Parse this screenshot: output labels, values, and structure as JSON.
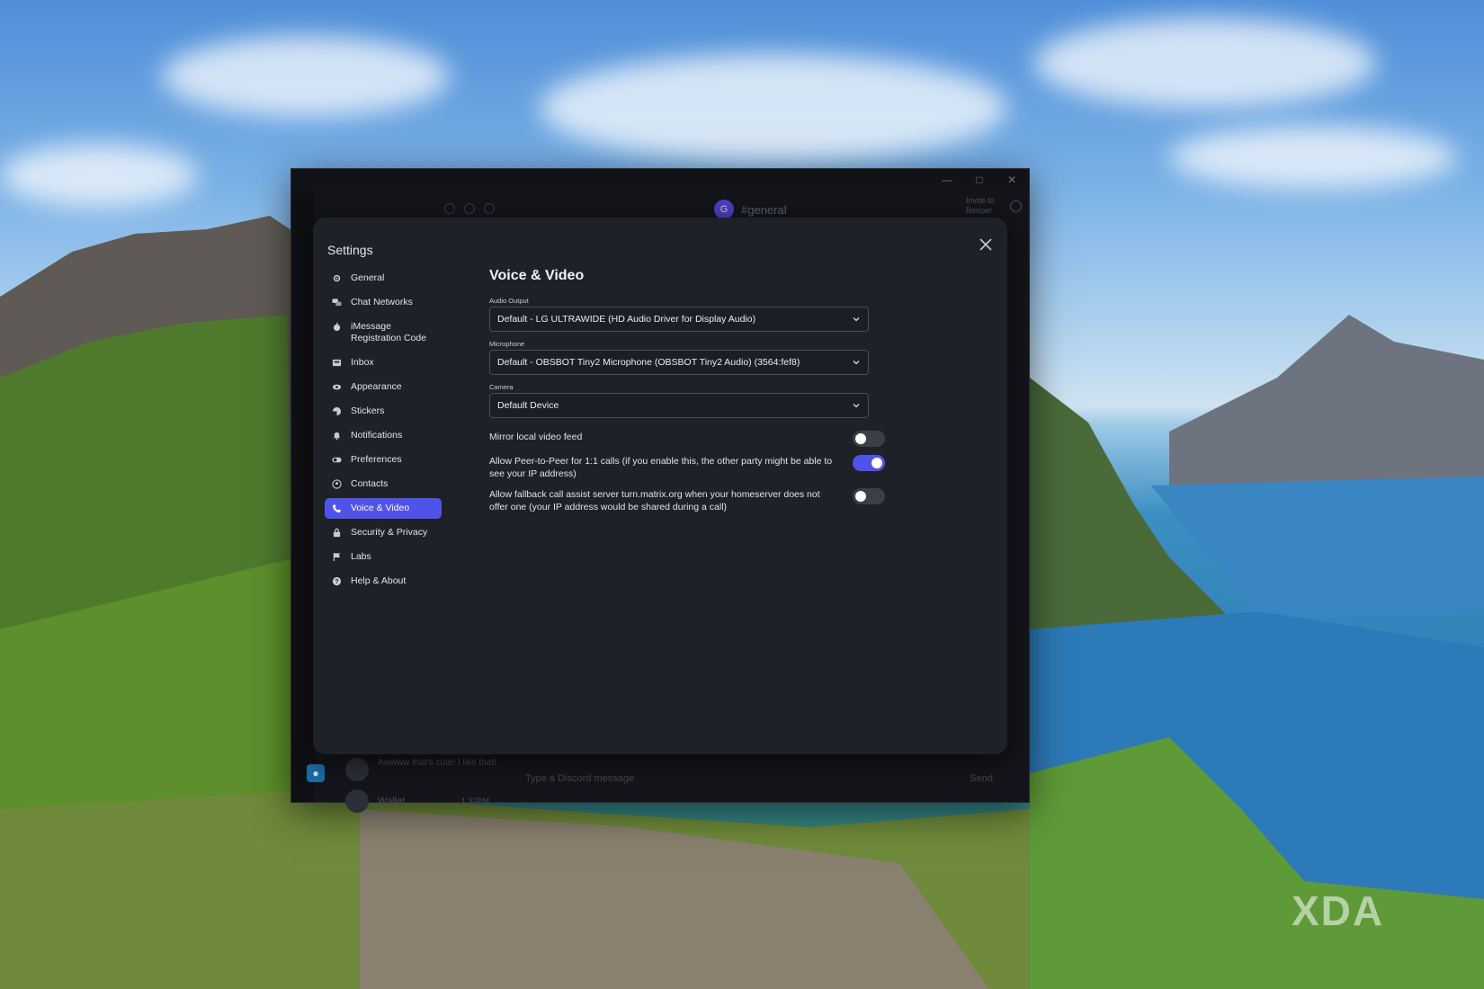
{
  "background_app": {
    "channel": "#general",
    "avatar_letter": "G",
    "invite_text": "Invite to Beeper",
    "preview_message": "Awwww that's cute! I like that!",
    "wallet_label": "Wallet",
    "wallet_time": "1:32PM",
    "composer_placeholder": "Type a Discord message",
    "send_label": "Send"
  },
  "watermark": "XDA",
  "settings": {
    "title": "Settings",
    "nav": [
      {
        "label": "General",
        "icon": "gear-icon"
      },
      {
        "label": "Chat Networks",
        "icon": "chat-bubbles-icon"
      },
      {
        "label": "iMessage Registration Code",
        "icon": "apple-icon"
      },
      {
        "label": "Inbox",
        "icon": "inbox-icon"
      },
      {
        "label": "Appearance",
        "icon": "eye-icon"
      },
      {
        "label": "Stickers",
        "icon": "sticker-icon"
      },
      {
        "label": "Notifications",
        "icon": "bell-icon"
      },
      {
        "label": "Preferences",
        "icon": "toggle-icon"
      },
      {
        "label": "Contacts",
        "icon": "contact-icon"
      },
      {
        "label": "Voice & Video",
        "icon": "phone-icon",
        "active": true
      },
      {
        "label": "Security & Privacy",
        "icon": "lock-icon"
      },
      {
        "label": "Labs",
        "icon": "flag-icon"
      },
      {
        "label": "Help & About",
        "icon": "help-icon"
      }
    ],
    "voice_video": {
      "heading": "Voice & Video",
      "audio_output_label": "Audio Output",
      "audio_output_value": "Default - LG ULTRAWIDE (HD Audio Driver for Display Audio)",
      "microphone_label": "Microphone",
      "microphone_value": "Default - OBSBOT Tiny2 Microphone (OBSBOT Tiny2 Audio) (3564:fef8)",
      "camera_label": "Camera",
      "camera_value": "Default Device",
      "toggles": [
        {
          "label": "Mirror local video feed",
          "on": false
        },
        {
          "label": "Allow Peer-to-Peer for 1:1 calls (if you enable this, the other party might be able to see your IP address)",
          "on": true
        },
        {
          "label": "Allow fallback call assist server turn.matrix.org when your homeserver does not offer one (your IP address would be shared during a call)",
          "on": false
        }
      ]
    }
  },
  "colors": {
    "accent": "#5053ea",
    "modal_bg": "#1f2129",
    "window_bg": "#16171c"
  }
}
